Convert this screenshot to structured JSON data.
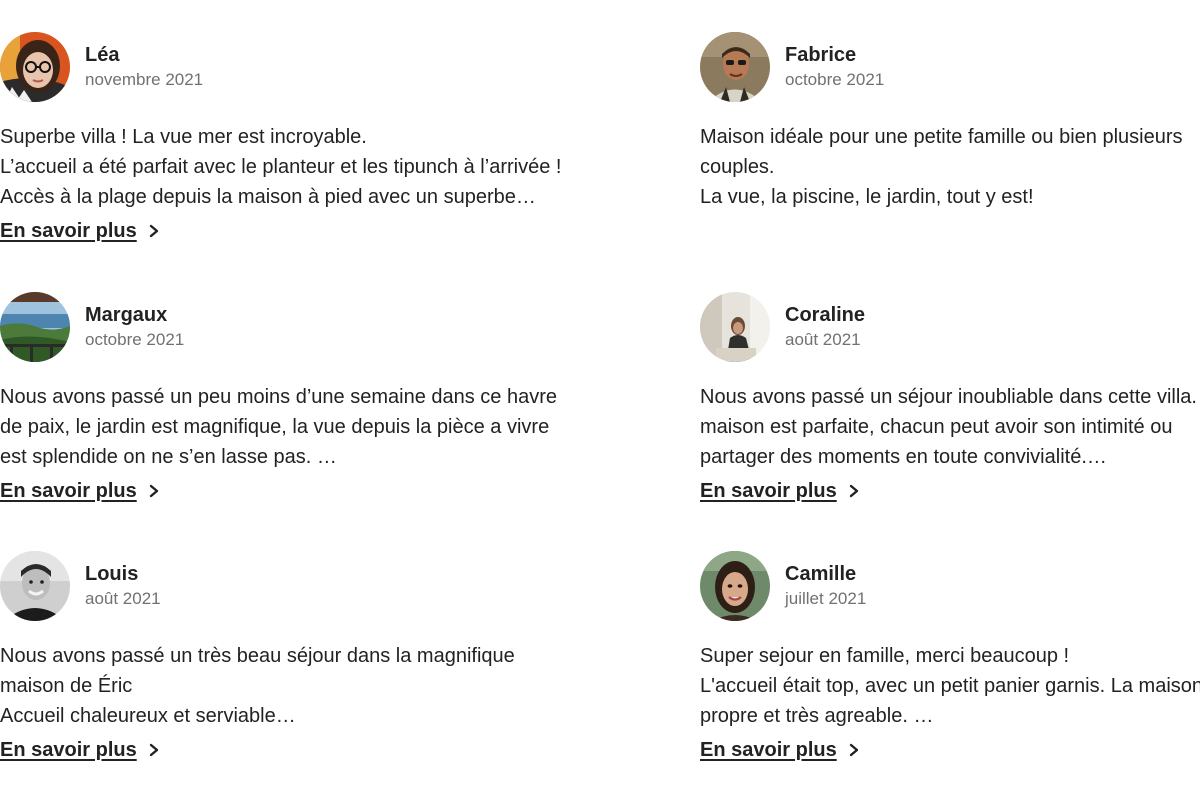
{
  "reviews": [
    {
      "name": "Léa",
      "date": "novembre 2021",
      "avatar": "avatar-photo-woman-glasses",
      "lines": [
        "Superbe villa ! La vue mer est incroyable.",
        "L’accueil a été parfait avec le planteur et les tipunch à l’arrivée !",
        "Accès à la plage depuis la maison à pied avec un superbe…"
      ],
      "read_more": "En savoir plus"
    },
    {
      "name": "Fabrice",
      "date": "octobre 2021",
      "avatar": "avatar-photo-man-sunglasses",
      "lines": [
        "Maison idéale pour une petite famille ou bien plusieurs",
        "couples.",
        "La vue, la piscine, le jardin, tout y est!"
      ],
      "read_more": ""
    },
    {
      "name": "Margaux",
      "date": "octobre 2021",
      "avatar": "avatar-photo-sea-view",
      "lines": [
        "Nous avons passé un peu moins d’une semaine dans ce havre",
        "de paix, le jardin est magnifique, la vue depuis la pièce a vivre",
        "est splendide on ne s’en lasse pas. …"
      ],
      "read_more": "En savoir plus"
    },
    {
      "name": "Coraline",
      "date": "août 2021",
      "avatar": "avatar-photo-woman-seated",
      "lines": [
        "Nous avons passé un séjour inoubliable dans cette villa. La",
        "maison est parfaite, chacun peut avoir son intimité ou",
        "partager des moments en toute convivialité.…"
      ],
      "read_more": "En savoir plus"
    },
    {
      "name": "Louis",
      "date": "août 2021",
      "avatar": "avatar-photo-man-bw",
      "lines": [
        "Nous avons passé un très beau séjour dans la magnifique",
        "maison de Éric",
        "Accueil chaleureux et serviable…"
      ],
      "read_more": "En savoir plus"
    },
    {
      "name": "Camille",
      "date": "juillet 2021",
      "avatar": "avatar-photo-woman-smiling",
      "lines": [
        "Super sejour en famille, merci beaucoup !",
        "L'accueil était top, avec un petit panier garnis. La maison",
        "propre et très agreable. …"
      ],
      "read_more": "En savoir plus"
    }
  ],
  "colors": {
    "text": "#222222",
    "muted": "#717171",
    "background": "#ffffff"
  }
}
